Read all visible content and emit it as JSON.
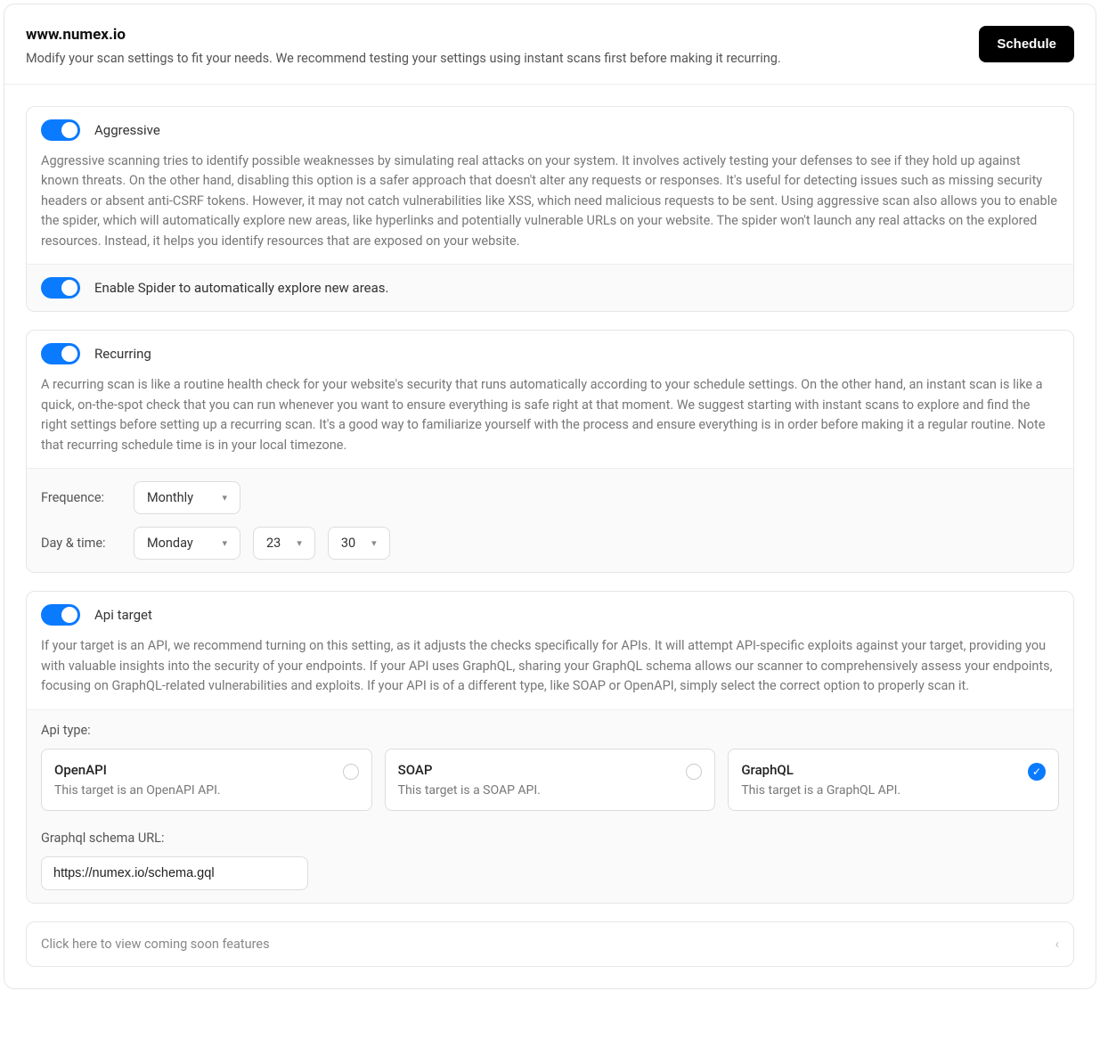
{
  "header": {
    "title": "www.numex.io",
    "subtitle": "Modify your scan settings to fit your needs. We recommend testing your settings using instant scans first before making it recurring.",
    "schedule_button": "Schedule"
  },
  "aggressive": {
    "label": "Aggressive",
    "description": "Aggressive scanning tries to identify possible weaknesses by simulating real attacks on your system. It involves actively testing your defenses to see if they hold up against known threats. On the other hand, disabling this option is a safer approach that doesn't alter any requests or responses. It's useful for detecting issues such as missing security headers or absent anti-CSRF tokens. However, it may not catch vulnerabilities like XSS, which need malicious requests to be sent. Using aggressive scan also allows you to enable the spider, which will automatically explore new areas, like hyperlinks and potentially vulnerable URLs on your website. The spider won't launch any real attacks on the explored resources. Instead, it helps you identify resources that are exposed on your website.",
    "spider_label": "Enable Spider to automatically explore new areas."
  },
  "recurring": {
    "label": "Recurring",
    "description": "A recurring scan is like a routine health check for your website's security that runs automatically according to your schedule settings. On the other hand, an instant scan is like a quick, on-the-spot check that you can run whenever you want to ensure everything is safe right at that moment. We suggest starting with instant scans to explore and find the right settings before setting up a recurring scan. It's a good way to familiarize yourself with the process and ensure everything is in order before making it a regular routine. Note that recurring schedule time is in your local timezone.",
    "frequence_label": "Frequence:",
    "frequence_value": "Monthly",
    "daytime_label": "Day & time:",
    "day_value": "Monday",
    "hour_value": "23",
    "minute_value": "30"
  },
  "api": {
    "label": "Api target",
    "description": "If your target is an API, we recommend turning on this setting, as it adjusts the checks specifically for APIs. It will attempt API-specific exploits against your target, providing you with valuable insights into the security of your endpoints. If your API uses GraphQL, sharing your GraphQL schema allows our scanner to comprehensively assess your endpoints, focusing on GraphQL-related vulnerabilities and exploits. If your API is of a different type, like SOAP or OpenAPI, simply select the correct option to properly scan it.",
    "type_label": "Api type:",
    "options": [
      {
        "title": "OpenAPI",
        "sub": "This target is an OpenAPI API.",
        "selected": false
      },
      {
        "title": "SOAP",
        "sub": "This target is a SOAP API.",
        "selected": false
      },
      {
        "title": "GraphQL",
        "sub": "This target is a GraphQL API.",
        "selected": true
      }
    ],
    "schema_label": "Graphql schema URL:",
    "schema_value": "https://numex.io/schema.gql"
  },
  "coming_soon": {
    "label": "Click here to view coming soon features"
  }
}
